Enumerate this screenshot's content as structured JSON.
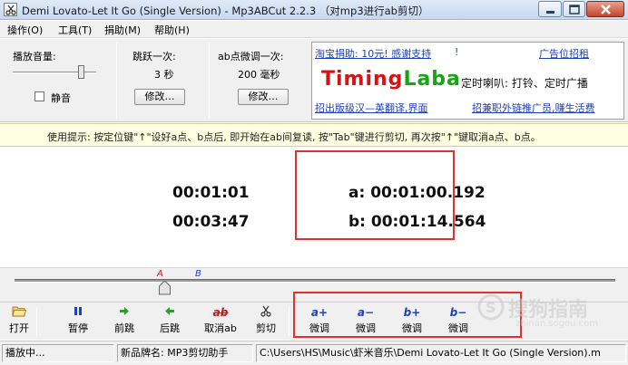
{
  "window": {
    "title": "Demi Lovato-Let It Go (Single Version) - Mp3ABCut 2.2.3 （对mp3进行ab剪切）"
  },
  "menu": [
    "操作(O)",
    "工具(T)",
    "捐助(M)",
    "帮助(H)"
  ],
  "volume": {
    "label": "播放音量:",
    "level": 0.85,
    "mute_label": "静音",
    "mute_checked": false
  },
  "skip": {
    "label": "跳跃一次:",
    "value": "3 秒",
    "button": "修改…"
  },
  "fine_tune": {
    "label": "ab点微调一次:",
    "value": "200 毫秒",
    "button": "修改…"
  },
  "ad": {
    "donate_link": "淘宝捐助: 10元! 感谢支持",
    "donate_suffix": "!",
    "ad_rent_link": "广告位招租",
    "logo_part1": "Timing",
    "logo_part2": "Laba",
    "tagline": "定时喇叭: 打铃、定时广播",
    "translate_link": "招出版级汉—英翻译,界面",
    "recruit_link": "招兼职外链推广员,赚生活费"
  },
  "hint": "使用提示: 按定位键\"↑\"设好a点、b点后, 即开始在ab间复读, 按\"Tab\"键进行剪切, 再次按\"↑\"键取消a点、b点。",
  "display": {
    "current_time": "00:01:01",
    "total_time": "00:03:47",
    "a_point": "a: 00:01:00.192",
    "b_point": "b: 00:01:14.564"
  },
  "progress": {
    "position_fraction": 0.27,
    "a_fraction": 0.265,
    "b_fraction": 0.328,
    "a_label": "A",
    "b_label": "B"
  },
  "toolbar": [
    {
      "icon": "open-folder",
      "label": "打开"
    },
    {
      "icon": "pause",
      "label": "暂停"
    },
    {
      "icon": "forward-arrow",
      "label": "前跳"
    },
    {
      "icon": "back-arrow",
      "label": "后跳"
    },
    {
      "icon": "cancel-ab",
      "label": "取消ab"
    },
    {
      "icon": "scissors",
      "label": "剪切"
    },
    {
      "icon": "a-plus",
      "glyph": "a+",
      "label": "微调"
    },
    {
      "icon": "a-minus",
      "glyph": "a−",
      "label": "微调"
    },
    {
      "icon": "b-plus",
      "glyph": "b+",
      "label": "微调"
    },
    {
      "icon": "b-minus",
      "glyph": "b−",
      "label": "微调"
    }
  ],
  "cancel_glyph": "ab",
  "status": {
    "state": "播放中...",
    "product": "新品牌名: MP3剪切助手",
    "path": "C:\\Users\\HS\\Music\\虾米音乐\\Demi Lovato-Let It Go (Single Version).m"
  },
  "watermark": {
    "text": "搜狗指南",
    "sub": "zhinan.sogou.com"
  },
  "colors": {
    "accent_red": "#e0312f",
    "link_blue": "#1e3fb8",
    "logo_red": "#d81212",
    "logo_green": "#1aa317"
  }
}
